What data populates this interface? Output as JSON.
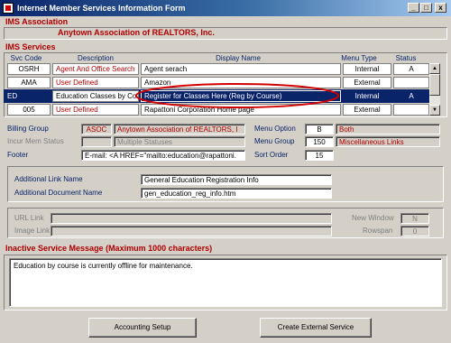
{
  "window": {
    "title": "Internet Member Services Information Form",
    "minimize": "_",
    "maximize": "□",
    "close": "x"
  },
  "association": {
    "header": "IMS Association",
    "name": "Anytown Association of REALTORS, Inc."
  },
  "services": {
    "header": "IMS Services",
    "columns": [
      "Svc Code",
      "Description",
      "Display Name",
      "Menu Type",
      "Status"
    ],
    "rows": [
      {
        "code": "OSRH",
        "description": "Agent And Office Search",
        "display_name": "Agent serach",
        "menu_type": "Internal",
        "status": "A"
      },
      {
        "code": "AMA",
        "description": "User Defined",
        "display_name": "Amazon",
        "menu_type": "External",
        "status": ""
      },
      {
        "code": "ED",
        "description": "Education Classes by Co",
        "display_name": "Register for Classes Here (Reg by Course)",
        "menu_type": "Internal",
        "status": "A"
      },
      {
        "code": "005",
        "description": "User Defined",
        "display_name": "Rapattoni Corporation Home page",
        "menu_type": "External",
        "status": ""
      }
    ]
  },
  "details": {
    "billing_group_label": "Billing Group",
    "billing_group_code": "ASOC",
    "billing_group_name": "Anytown Association of REALTORS, I",
    "incur_mem_status_label": "Incur Mem Status",
    "incur_mem_status_value": "Multiple Statuses",
    "footer_label": "Footer",
    "footer_value": "E-mail: <A HREF=\"mailto:education@rapattoni.",
    "menu_option_label": "Menu Option",
    "menu_option_value": "B",
    "menu_option_desc": "Both",
    "menu_group_label": "Menu Group",
    "menu_group_value": "150",
    "menu_group_desc": "Miscellaneous Links",
    "sort_order_label": "Sort Order",
    "sort_order_value": "15"
  },
  "additional": {
    "link_name_label": "Additional Link Name",
    "link_name_value": "General Education Registration Info",
    "document_name_label": "Additional Document Name",
    "document_name_value": "gen_education_reg_info.htm"
  },
  "url": {
    "url_link_label": "URL Link",
    "image_link_label": "Image Link",
    "new_window_label": "New Window",
    "new_window_value": "N",
    "rowspan_label": "Rowspan",
    "rowspan_value": "0"
  },
  "inactive": {
    "header": "Inactive Service Message (Maximum 1000 characters)",
    "message": "Education by course is currently offline for maintenance."
  },
  "buttons": {
    "accounting_setup": "Accounting Setup",
    "create_external_service": "Create External Service"
  },
  "colors": {
    "titlebar": "#0a246a",
    "section_header": "#b00000",
    "selection": "#0a246a",
    "highlight_ellipse": "#d00000"
  }
}
